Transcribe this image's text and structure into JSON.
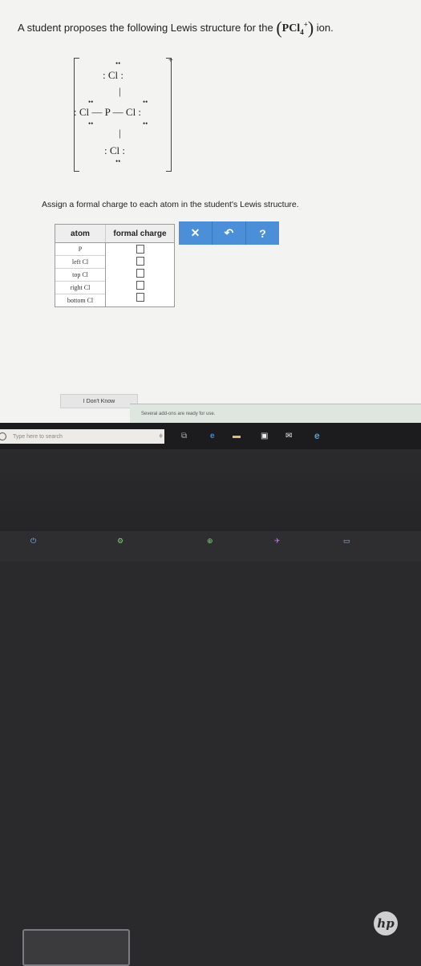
{
  "question": {
    "text": "A student proposes the following Lewis structure for the",
    "formula_base": "PCl",
    "formula_sub": "4",
    "formula_sup": "+",
    "ion_word": "ion."
  },
  "lewis": {
    "charge": "+",
    "top_dots": "••",
    "top_atom": ": Cl :",
    "left_dots_top": "••",
    "right_dots_top": "••",
    "middle_row": ": Cl — P — Cl :",
    "left_dots_bottom": "••",
    "right_dots_bottom": "••",
    "bottom_atom": ": Cl :",
    "bottom_dots": "••"
  },
  "instruction": "Assign a formal charge to each atom in the student's Lewis structure.",
  "table": {
    "header_atom": "atom",
    "header_charge": "formal charge",
    "rows": [
      {
        "atom": "P",
        "value": ""
      },
      {
        "atom": "left Cl",
        "value": ""
      },
      {
        "atom": "top Cl",
        "value": ""
      },
      {
        "atom": "right Cl",
        "value": ""
      },
      {
        "atom": "bottom Cl",
        "value": ""
      }
    ]
  },
  "toolbar": {
    "clear": "✕",
    "undo": "↶",
    "help": "?"
  },
  "dont_know": "I Don't Know",
  "addons_notice": "Several add-ons are ready for use.",
  "taskbar": {
    "search_placeholder": "Type here to search"
  },
  "laptop_logo": "hp"
}
